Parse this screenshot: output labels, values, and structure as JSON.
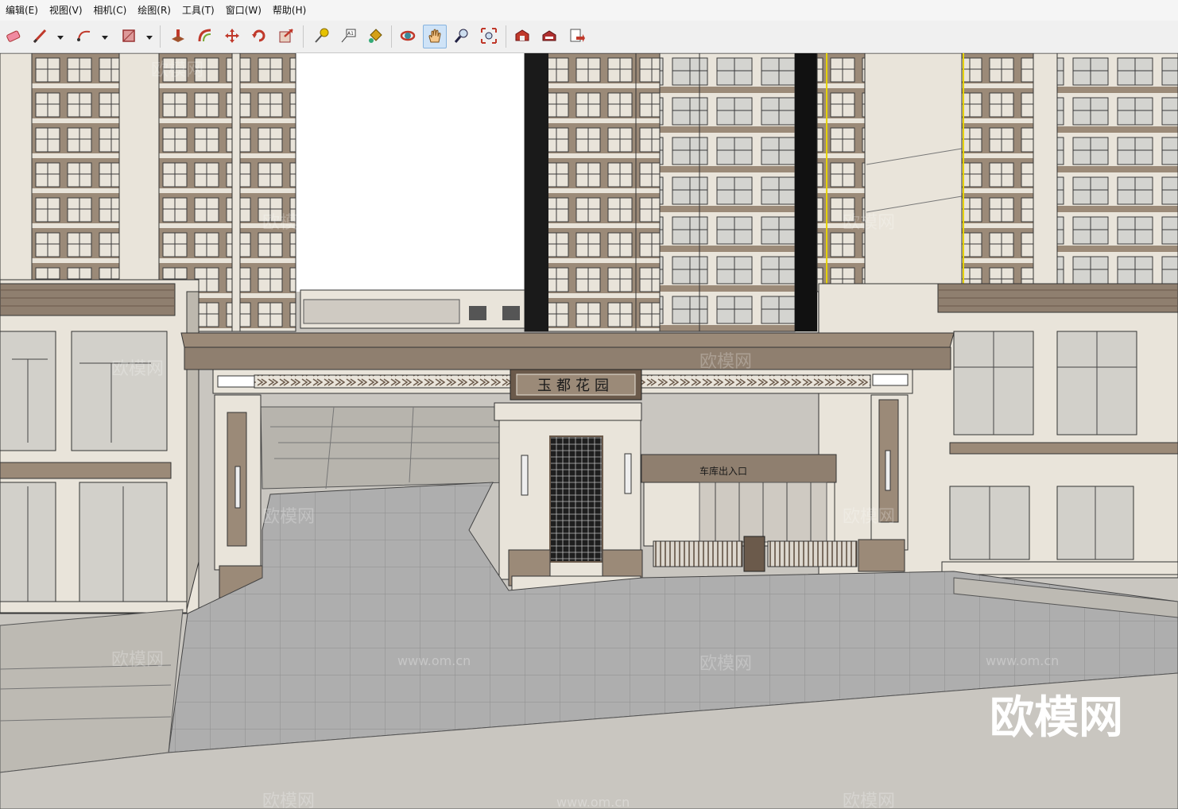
{
  "menu": {
    "items": [
      "编辑(E)",
      "视图(V)",
      "相机(C)",
      "绘图(R)",
      "工具(T)",
      "窗口(W)",
      "帮助(H)"
    ]
  },
  "toolbar": {
    "tools": [
      {
        "icon": "eraser-icon",
        "label": "eraser"
      },
      {
        "icon": "pencil-icon",
        "label": "line"
      },
      {
        "icon": "arc-icon",
        "label": "arc"
      },
      {
        "icon": "rectangle-icon",
        "label": "rectangle"
      },
      {
        "icon": "push-pull-icon",
        "label": "push/pull"
      },
      {
        "icon": "offset-icon",
        "label": "offset"
      },
      {
        "icon": "move-icon",
        "label": "move"
      },
      {
        "icon": "rotate-icon",
        "label": "rotate"
      },
      {
        "icon": "scale-icon",
        "label": "scale"
      },
      {
        "icon": "tape-measure-icon",
        "label": "tape measure"
      },
      {
        "icon": "text-icon",
        "label": "text"
      },
      {
        "icon": "paint-bucket-icon",
        "label": "paint bucket"
      },
      {
        "icon": "orbit-icon",
        "label": "orbit"
      },
      {
        "icon": "pan-icon",
        "label": "pan"
      },
      {
        "icon": "zoom-icon",
        "label": "zoom"
      },
      {
        "icon": "zoom-extents-icon",
        "label": "zoom extents"
      },
      {
        "icon": "warehouse-icon",
        "label": "3D warehouse"
      },
      {
        "icon": "extension-warehouse-icon",
        "label": "extension warehouse"
      },
      {
        "icon": "send-to-layout-icon",
        "label": "send to layout"
      }
    ],
    "active_tool": "pan-icon",
    "text_tool_glyph": "A1"
  },
  "scene": {
    "gate_sign": "玉都花园",
    "garage_sign": "车库出入口",
    "watermark_brand": "欧模网",
    "watermark_url": "www.om.cn",
    "colors": {
      "wall_tan": "#9b8a78",
      "wall_light": "#e9e4da",
      "sky": "#ffffff",
      "pavement": "#aeaeae",
      "ground": "#c9c6c0",
      "glass": "#b9c2c6",
      "dark_trim": "#6b5a4b"
    }
  }
}
